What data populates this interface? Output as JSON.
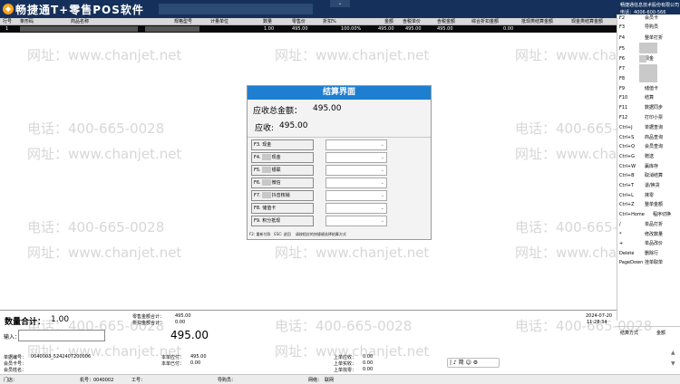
{
  "window": {
    "app_title": "畅捷通T+零售POS软件",
    "dropdown_glyph": "⌄",
    "company": "畅捷通信息技术股份有限公司",
    "phone": "电话：4006-600-566"
  },
  "table": {
    "columns": [
      "行号",
      "条形码",
      "商品名称",
      "规格型号",
      "计量单位",
      "数量",
      "零售价",
      "折扣%",
      "金额",
      "含税单价",
      "含税金额",
      "综合折扣金额",
      "抵现类结算金额",
      "现金类结算金额"
    ],
    "row": {
      "line_no": "1",
      "quantity": "1.00",
      "retail_price": "495.00",
      "discount": "100.00%",
      "amount": "495.00",
      "tax_unit_price": "495.00",
      "tax_amount": "495.00",
      "overall_discount": "0.00"
    }
  },
  "watermarks": {
    "site": "网址：www.chanjet.net",
    "tel": "电话：400-665-0028"
  },
  "sidebar": {
    "items": [
      {
        "key": "F2",
        "label": "会员卡"
      },
      {
        "key": "F3",
        "label": "导购员"
      },
      {
        "key": "F4",
        "label": "整单打折"
      },
      {
        "key": "F5",
        "label": ""
      },
      {
        "key": "F6",
        "label": "现金"
      },
      {
        "key": "F7",
        "label": ""
      },
      {
        "key": "F8",
        "label": ""
      },
      {
        "key": "F9",
        "label": "储值卡"
      },
      {
        "key": "F10",
        "label": "结算"
      },
      {
        "key": "F11",
        "label": "数据同步"
      },
      {
        "key": "F12",
        "label": "打印小票"
      },
      {
        "key": "Ctrl+J",
        "label": "单据查询"
      },
      {
        "key": "Ctrl+S",
        "label": "商品查询"
      },
      {
        "key": "Ctrl+Q",
        "label": "会员查询"
      },
      {
        "key": "Ctrl+G",
        "label": "赠送"
      },
      {
        "key": "Ctrl+W",
        "label": "赢库存"
      },
      {
        "key": "Ctrl+B",
        "label": "取消结算"
      },
      {
        "key": "Ctrl+T",
        "label": "退/换货"
      },
      {
        "key": "Ctrl+L",
        "label": "抹零"
      },
      {
        "key": "Ctrl+Z",
        "label": "整单金额"
      },
      {
        "key": "Ctrl+Home",
        "label": "程序切换"
      },
      {
        "key": "/",
        "label": "单品打折"
      },
      {
        "key": "*",
        "label": "修改数量"
      },
      {
        "key": "+",
        "label": "单品改价"
      },
      {
        "key": "Delete",
        "label": "删除行"
      },
      {
        "key": "PageDown",
        "label": "挂单取单"
      }
    ]
  },
  "modal": {
    "title": "结算界面",
    "total_label": "应收总金额：",
    "total_value": "495.00",
    "received_label": "应收:",
    "received_value": "495.00",
    "methods": [
      {
        "key": "F3.",
        "label": "现金"
      },
      {
        "key": "F4.",
        "label": "现金"
      },
      {
        "key": "F5.",
        "label": "银联"
      },
      {
        "key": "F6.",
        "label": "微信"
      },
      {
        "key": "F7.",
        "label": "抖音核销"
      },
      {
        "key": "F8.",
        "label": "储值卡"
      },
      {
        "key": "F9.",
        "label": "积分抵现"
      }
    ],
    "field_glyph": "⌄",
    "footer_keys": "F2: 重新付款",
    "footer_esc": "ESC: 退回",
    "footer_hint": "请按相应的快捷键选择结算方式"
  },
  "bottom": {
    "qty_label": "数量合计：",
    "qty_value": "1.00",
    "retail_total_label": "零售金额合计：",
    "retail_total_value": "495.00",
    "discount_total_label": "折扣金额合计：",
    "discount_total_value": "0.00",
    "date": "2024-07-20",
    "time": "11:28:34",
    "input_label": "输入：",
    "big_amount": "495.00",
    "pay_mode_label": "结算方式",
    "pay_mode_value": "金额"
  },
  "info": {
    "bill_no_label": "单据编号：",
    "bill_no_value": "0040003_5242407200006",
    "member_card_label": "会员卡号：",
    "member_name_label": "会员姓名：",
    "receivable_label": "本单应付：",
    "receivable_value": "495.00",
    "paid_label": "本单已付：",
    "paid_value": "0.00",
    "last_recv_label": "上单应收：",
    "last_recv_value": "0.00",
    "last_paid_label": "上单实收：",
    "last_paid_value": "0.00",
    "last_change_label": "上单找零：",
    "last_change_value": "0.00",
    "change_label": "本单已付：",
    "change_value": "0.00"
  },
  "status": {
    "store": "门店：",
    "terminal": "机号：0040002",
    "staff": "工号：",
    "guide": "导购员：",
    "network_label": "网络：",
    "network_value": "联网"
  },
  "ime": {
    "text": "| ♪ 简 ☺ ⚙"
  }
}
